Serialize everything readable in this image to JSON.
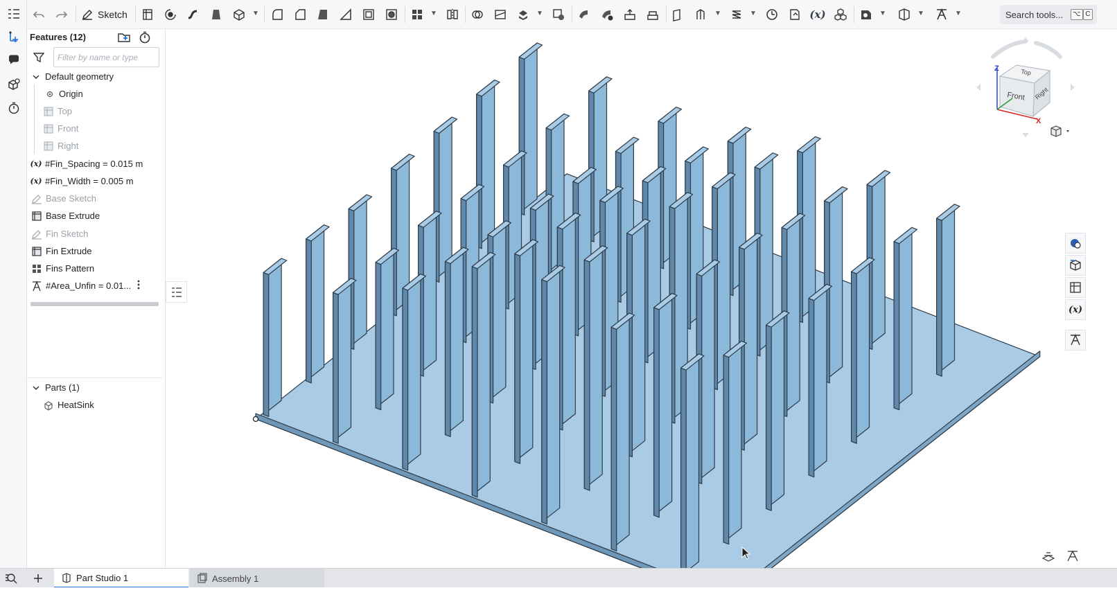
{
  "toolbar": {
    "sketch_label": "Sketch",
    "search_label": "Search tools...",
    "search_shortcut": [
      "⌥",
      "C"
    ],
    "variable_label": "(x)"
  },
  "feature_panel": {
    "header": "Features (12)",
    "filter_placeholder": "Filter by name or type",
    "default_geometry_label": "Default geometry",
    "default_geometry_items": [
      "Origin",
      "Top",
      "Front",
      "Right"
    ],
    "features": [
      {
        "label": "#Fin_Spacing = 0.015 m",
        "icon": "variable-icon",
        "dim": false
      },
      {
        "label": "#Fin_Width = 0.005 m",
        "icon": "variable-icon",
        "dim": false
      },
      {
        "label": "Base Sketch",
        "icon": "sketch-icon",
        "dim": true
      },
      {
        "label": "Base Extrude",
        "icon": "extrude-icon",
        "dim": false
      },
      {
        "label": "Fin Sketch",
        "icon": "sketch-icon",
        "dim": true
      },
      {
        "label": "Fin Extrude",
        "icon": "extrude-icon",
        "dim": false
      },
      {
        "label": "Fins Pattern",
        "icon": "pattern-icon",
        "dim": false
      },
      {
        "label": "#Area_Unfin = 0.01...",
        "icon": "measure-icon",
        "dim": false
      }
    ],
    "parts_header": "Parts (1)",
    "parts": [
      "HeatSink"
    ]
  },
  "view_cube": {
    "face_front": "Front",
    "face_top": "Top",
    "face_right": "Right",
    "axis_x": "X",
    "axis_z": "Z"
  },
  "tabs": [
    {
      "label": "Part Studio 1",
      "active": true
    },
    {
      "label": "Assembly 1",
      "active": false
    }
  ],
  "colors": {
    "part_face": "#8cb9da",
    "part_top": "#a9cbe6",
    "part_edge": "#2e3b47",
    "accent": "#1f6fd6"
  }
}
